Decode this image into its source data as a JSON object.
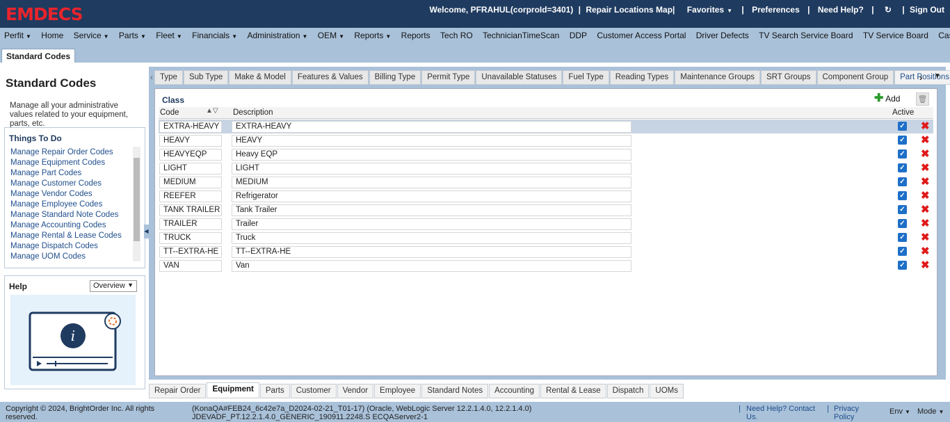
{
  "header": {
    "logo": "EMDECS",
    "welcome": "Welcome, PFRAHUL(corproId=3401)",
    "sep": "|",
    "repair_map": "Repair Locations Map|",
    "favorites": "Favorites",
    "preferences": "Preferences",
    "help": "Need Help?",
    "signout": "Sign Out"
  },
  "nav": [
    "Perfit",
    "Home",
    "Service",
    "Parts",
    "Fleet",
    "Financials",
    "Administration",
    "OEM",
    "Reports",
    "Reports",
    "Tech RO",
    "TechnicianTimeScan",
    "DDP",
    "Customer Access Portal",
    "Driver Defects",
    "TV Search Service Board",
    "TV Service Board",
    "Cashier Shift"
  ],
  "page_tab": "Standard Codes",
  "left": {
    "title": "Standard Codes",
    "desc": "Manage all your administrative values related to your equipment, parts, etc.",
    "todo_title": "Things To Do",
    "todo": [
      "Manage Repair Order Codes",
      "Manage Equipment Codes",
      "Manage Part Codes",
      "Manage Customer Codes",
      "Manage Vendor Codes",
      "Manage Employee Codes",
      "Manage Standard Note Codes",
      "Manage Accounting Codes",
      "Manage Rental & Lease Codes",
      "Manage Dispatch Codes",
      "Manage UOM Codes"
    ],
    "help_title": "Help",
    "help_select": "Overview"
  },
  "tabs": [
    "Type",
    "Sub Type",
    "Make & Model",
    "Features & Values",
    "Billing Type",
    "Permit Type",
    "Unavailable Statuses",
    "Fuel Type",
    "Reading Types",
    "Maintenance Groups",
    "SRT Groups",
    "Component Group",
    "Part Positions"
  ],
  "panel": {
    "title": "Class",
    "add": "Add",
    "col_code": "Code",
    "col_desc": "Description",
    "col_active": "Active"
  },
  "rows": [
    {
      "code": "EXTRA-HEAVY",
      "desc": "EXTRA-HEAVY",
      "active": true
    },
    {
      "code": "HEAVY",
      "desc": "HEAVY",
      "active": true
    },
    {
      "code": "HEAVYEQP",
      "desc": "Heavy EQP",
      "active": true
    },
    {
      "code": "LIGHT",
      "desc": "LIGHT",
      "active": true
    },
    {
      "code": "MEDIUM",
      "desc": "MEDIUM",
      "active": true
    },
    {
      "code": "REEFER",
      "desc": "Refrigerator",
      "active": true
    },
    {
      "code": "TANK TRAILER",
      "desc": "Tank Trailer",
      "active": true
    },
    {
      "code": "TRAILER",
      "desc": "Trailer",
      "active": true
    },
    {
      "code": "TRUCK",
      "desc": "Truck",
      "active": true
    },
    {
      "code": "TT--EXTRA-HE",
      "desc": "TT--EXTRA-HE",
      "active": true
    },
    {
      "code": "VAN",
      "desc": "Van",
      "active": true
    }
  ],
  "bottom_tabs": [
    "Repair Order",
    "Equipment",
    "Parts",
    "Customer",
    "Vendor",
    "Employee",
    "Standard Notes",
    "Accounting",
    "Rental & Lease",
    "Dispatch",
    "UOMs"
  ],
  "footer": {
    "copyright": "Copyright © 2024, BrightOrder Inc. All rights reserved.",
    "build": "(KonaQA#FEB24_6c42e7a_D2024-02-21_T01-17) (Oracle, WebLogic Server 12.2.1.4.0, 12.2.1.4.0) JDEVADF_PT.12.2.1.4.0_GENERIC_190911.2248.S ECQAServer2-1",
    "help": "Need Help? Contact Us.",
    "privacy": "Privacy Policy",
    "env": "Env",
    "mode": "Mode"
  }
}
